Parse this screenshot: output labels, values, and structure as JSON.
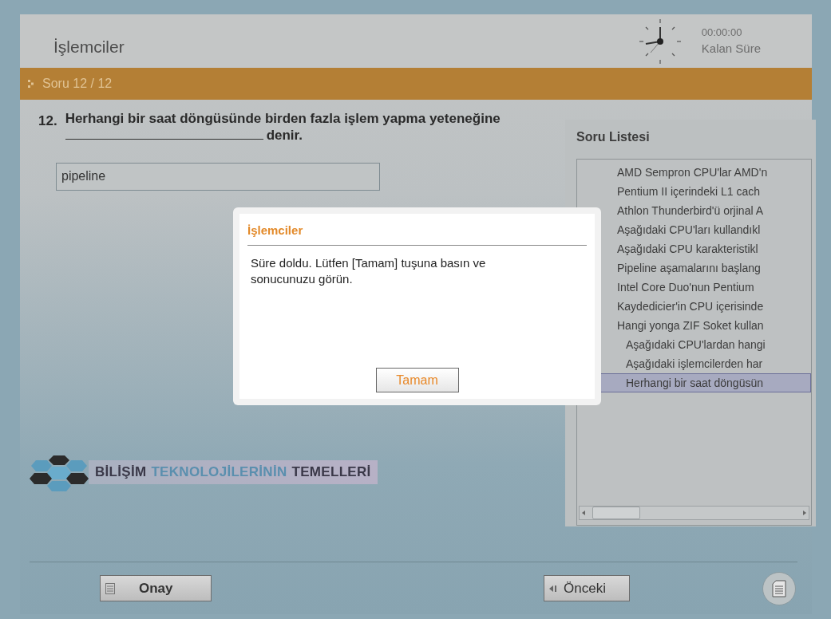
{
  "header": {
    "title": "İşlemciler",
    "timer": "00:00:00",
    "timer_label": "Kalan Süre"
  },
  "question_bar": {
    "label": "Soru 12 / 12"
  },
  "question": {
    "number": "12.",
    "text": "Herhangi bir saat döngüsünde birden fazla işlem yapma yeteneğine",
    "after_blank": "denir.",
    "answer": "pipeline"
  },
  "question_list": {
    "title": "Soru Listesi",
    "items": [
      {
        "label": "AMD Sempron CPU'lar AMD'n",
        "selected": false,
        "indented": false
      },
      {
        "label": "Pentium II içerindeki L1 cach",
        "selected": false,
        "indented": false
      },
      {
        "label": "Athlon Thunderbird'ü orjinal A",
        "selected": false,
        "indented": false
      },
      {
        "label": "Aşağıdaki CPU'ları kullandıkl",
        "selected": false,
        "indented": false
      },
      {
        "label": "Aşağıdaki CPU karakteristikl",
        "selected": false,
        "indented": false
      },
      {
        "label": "Pipeline aşamalarını başlang",
        "selected": false,
        "indented": false
      },
      {
        "label": "Intel Core Duo'nun Pentium",
        "selected": false,
        "indented": false
      },
      {
        "label": "Kaydedicier'in CPU içerisinde",
        "selected": false,
        "indented": false
      },
      {
        "label": "Hangi yonga ZIF Soket kullan",
        "selected": false,
        "indented": false
      },
      {
        "label": "Aşağıdaki CPU'lardan hangi",
        "selected": false,
        "indented": true
      },
      {
        "label": "Aşağıdaki işlemcilerden har",
        "selected": false,
        "indented": true
      },
      {
        "label": "Herhangi bir saat döngüsün",
        "selected": true,
        "indented": true
      }
    ]
  },
  "logo": {
    "words": [
      {
        "text": "BİLİŞİM",
        "color": "#3a3848"
      },
      {
        "text": "TEKNOLOJİLERİNİN",
        "color": "#5a8fae"
      },
      {
        "text": "TEMELLERİ",
        "color": "#3a3848"
      }
    ]
  },
  "footer": {
    "confirm": "Onay",
    "previous": "Önceki"
  },
  "dialog": {
    "title": "İşlemciler",
    "message": "Süre doldu. Lütfen [Tamam] tuşuna basın ve sonucunuzu görün.",
    "button": "Tamam"
  }
}
